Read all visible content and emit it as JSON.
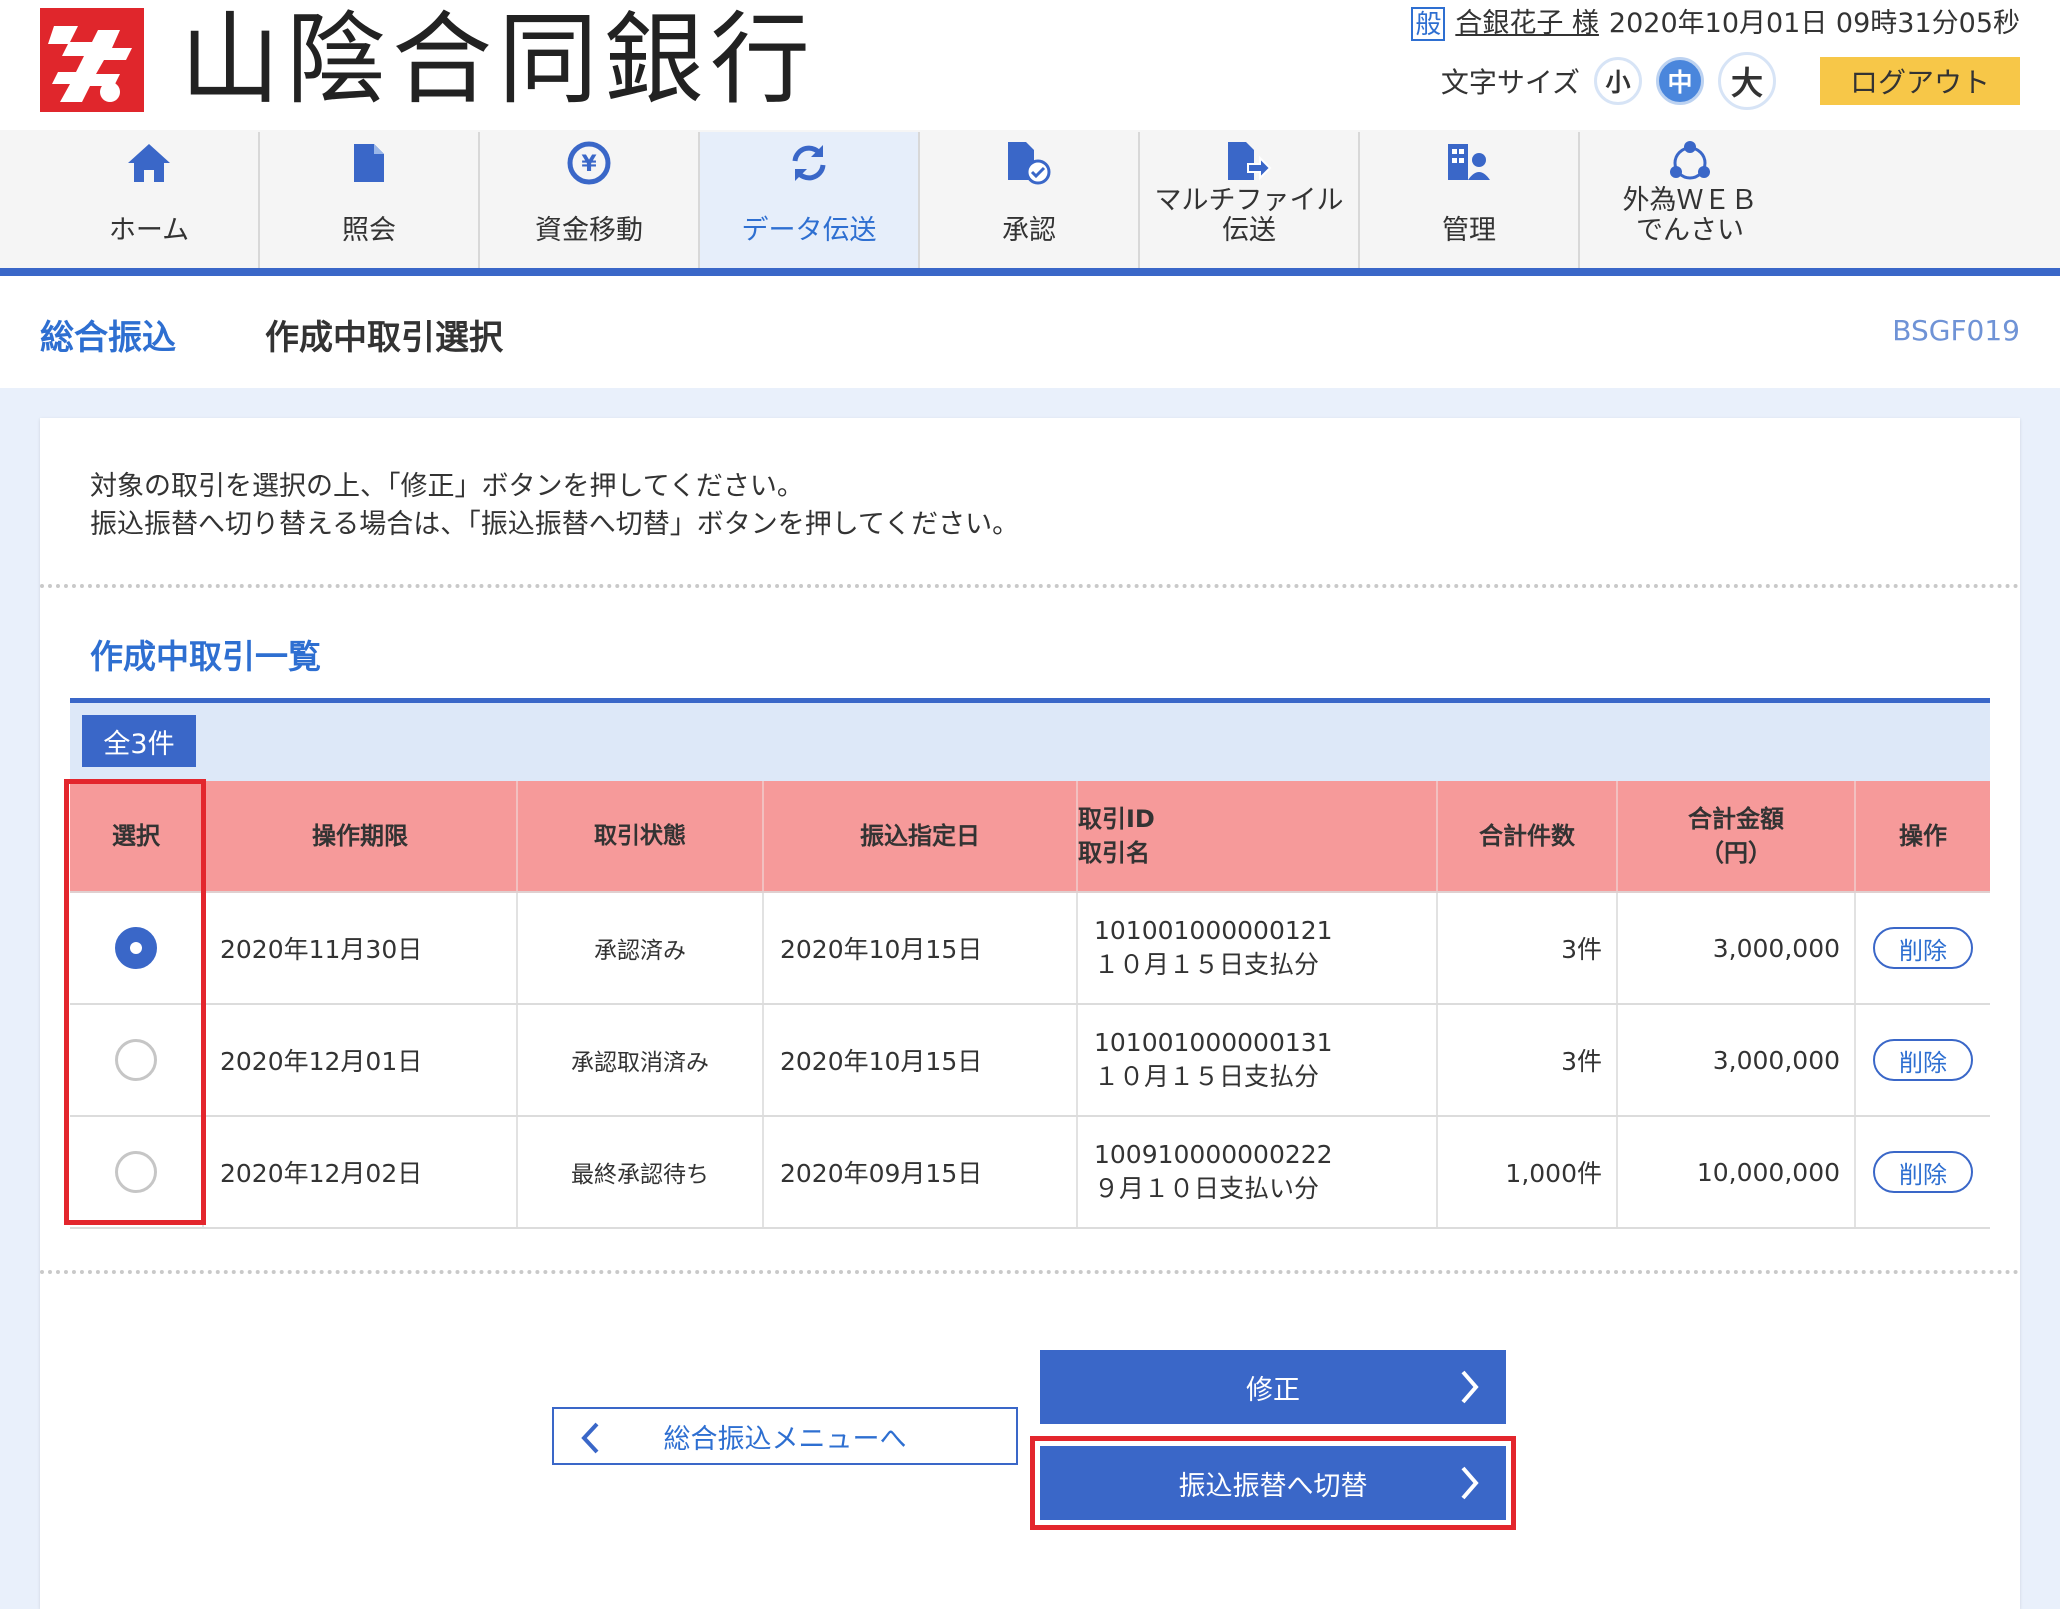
{
  "header": {
    "bank_name": "山陰合同銀行",
    "user_badge": "般",
    "user_name": "合銀花子 様",
    "datetime": "2020年10月01日 09時31分05秒",
    "font_size_label": "文字サイズ",
    "font_small": "小",
    "font_medium": "中",
    "font_large": "大",
    "logout": "ログアウト"
  },
  "nav": {
    "items": [
      {
        "label": "ホーム",
        "icon": "home-icon"
      },
      {
        "label": "照会",
        "icon": "document-icon"
      },
      {
        "label": "資金移動",
        "icon": "yen-transfer-icon"
      },
      {
        "label": "データ伝送",
        "icon": "refresh-icon"
      },
      {
        "label": "承認",
        "icon": "approve-icon"
      },
      {
        "label": "マルチファイル\n伝送",
        "icon": "file-send-icon"
      },
      {
        "label": "管理",
        "icon": "admin-icon"
      },
      {
        "label": "外為ＷＥＢ\nでんさい",
        "icon": "network-icon"
      }
    ],
    "active_index": 3,
    "accent_color": "#3a67c8"
  },
  "page": {
    "category": "総合振込",
    "title": "作成中取引選択",
    "code": "BSGF019"
  },
  "instruction": {
    "line1": "対象の取引を選択の上、「修正」ボタンを押してください。",
    "line2": "振込振替へ切り替える場合は、「振込振替へ切替」ボタンを押してください。"
  },
  "list": {
    "title": "作成中取引一覧",
    "count": "全3件",
    "headers": {
      "select": "選択",
      "deadline": "操作期限",
      "status": "取引状態",
      "date": "振込指定日",
      "id_line1": "取引ID",
      "id_line2": "取引名",
      "count": "合計件数",
      "amount_line1": "合計金額",
      "amount_line2": "（円）",
      "action": "操作"
    },
    "rows": [
      {
        "selected": true,
        "deadline": "2020年11月30日",
        "status": "承認済み",
        "date": "2020年10月15日",
        "id": "101001000000121",
        "name": "１０月１５日支払分",
        "count": "3件",
        "amount": "3,000,000",
        "action": "削除"
      },
      {
        "selected": false,
        "deadline": "2020年12月01日",
        "status": "承認取消済み",
        "date": "2020年10月15日",
        "id": "101001000000131",
        "name": "１０月１５日支払分",
        "count": "3件",
        "amount": "3,000,000",
        "action": "削除"
      },
      {
        "selected": false,
        "deadline": "2020年12月02日",
        "status": "最終承認待ち",
        "date": "2020年09月15日",
        "id": "100910000000222",
        "name": "９月１０日支払い分",
        "count": "1,000件",
        "amount": "10,000,000",
        "action": "削除"
      }
    ]
  },
  "buttons": {
    "back": "総合振込メニューへ",
    "edit": "修正",
    "switch": "振込振替へ切替"
  }
}
